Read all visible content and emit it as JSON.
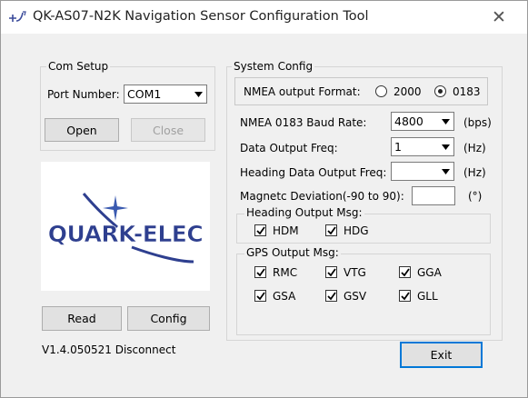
{
  "window": {
    "title": "QK-AS07-N2K Navigation Sensor Configuration Tool",
    "close_glyph": "✕"
  },
  "com_setup": {
    "title": "Com Setup",
    "port_label": "Port Number:",
    "port_value": "COM1",
    "open_label": "Open",
    "close_label": "Close"
  },
  "logo": {
    "text": "QUARK-ELEC",
    "primary_color": "#2e3f8f",
    "star_color": "#3a5ab0"
  },
  "actions": {
    "read_label": "Read",
    "config_label": "Config",
    "exit_label": "Exit"
  },
  "status": {
    "text": "V1.4.050521 Disconnect"
  },
  "system_config": {
    "title": "System Config",
    "nmea_format_label": "NMEA output Format:",
    "format_options": [
      {
        "label": "2000",
        "selected": false
      },
      {
        "label": "0183",
        "selected": true
      }
    ],
    "baud_label": "NMEA 0183 Baud Rate:",
    "baud_value": "4800",
    "baud_unit": "(bps)",
    "freq_label": "Data Output Freq:",
    "freq_value": "1",
    "freq_unit": "(Hz)",
    "heading_freq_label": "Heading Data Output Freq:",
    "heading_freq_value": "",
    "heading_freq_unit": "(Hz)",
    "mag_label": "Magnetc Deviation(-90 to 90):",
    "mag_value": "",
    "mag_unit": "(°)"
  },
  "heading_msg": {
    "title": "Heading Output Msg:",
    "items": [
      {
        "label": "HDM",
        "checked": true
      },
      {
        "label": "HDG",
        "checked": true
      }
    ]
  },
  "gps_msg": {
    "title": "GPS Output Msg:",
    "items": [
      {
        "label": "RMC",
        "checked": true
      },
      {
        "label": "VTG",
        "checked": true
      },
      {
        "label": "GGA",
        "checked": true
      },
      {
        "label": "GSA",
        "checked": true
      },
      {
        "label": "GSV",
        "checked": true
      },
      {
        "label": "GLL",
        "checked": true
      }
    ]
  }
}
